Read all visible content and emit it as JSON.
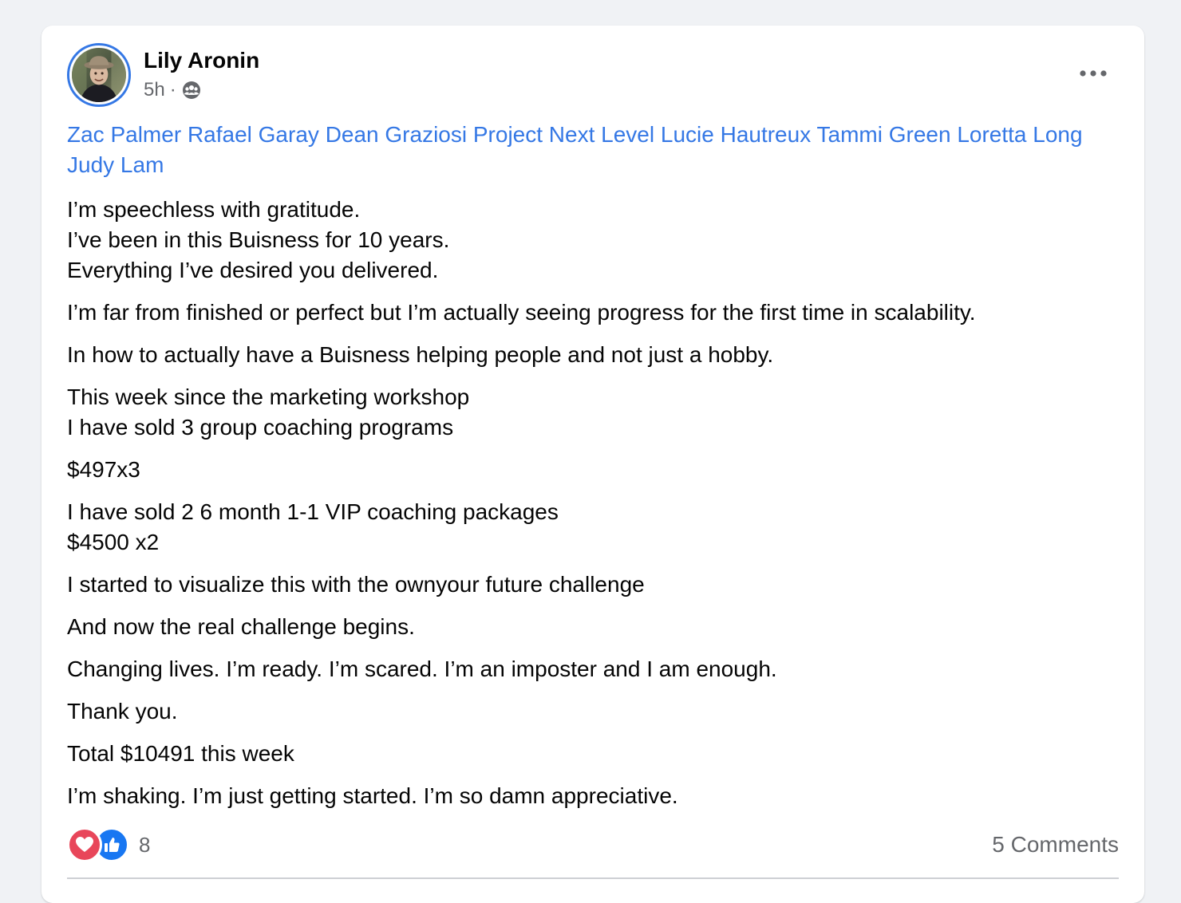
{
  "post": {
    "author": "Lily Aronin",
    "time": "5h",
    "separator": "·",
    "audience_icon": "friends-icon",
    "more_icon": "more-horizontal-icon",
    "tags": [
      "Zac Palmer",
      "Rafael Garay",
      "Dean Graziosi",
      "Project Next Level",
      "Lucie Hautreux",
      "Tammi Green",
      "Loretta Long",
      "Judy Lam"
    ],
    "paragraphs": [
      [
        "I’m speechless with gratitude.",
        "I’ve been in this Buisness for 10 years.",
        "Everything I’ve desired you delivered."
      ],
      [
        "I’m far from finished or perfect but I’m actually seeing progress for the first time in scalability."
      ],
      [
        "In how to actually have a Buisness helping people and not just a hobby."
      ],
      [
        "This week since the marketing workshop",
        "I have sold 3 group coaching programs"
      ],
      [
        "$497x3"
      ],
      [
        "I have sold 2 6 month 1-1 VIP coaching packages",
        "$4500 x2"
      ],
      [
        "I started to visualize this with the ownyour future challenge"
      ],
      [
        "And now the real challenge begins."
      ],
      [
        "Changing lives. I’m ready. I’m scared. I’m an imposter and I am enough."
      ],
      [
        "Thank you."
      ],
      [
        "Total $10491 this week"
      ],
      [
        "I’m shaking. I’m just getting started. I’m so damn appreciative."
      ]
    ],
    "reactions": {
      "icons": [
        "love-icon",
        "like-icon"
      ],
      "count": "8"
    },
    "comments_label": "5 Comments"
  },
  "colors": {
    "page_bg": "#f0f2f5",
    "card_bg": "#ffffff",
    "link": "#3578e5",
    "secondary_text": "#65676b",
    "love": "#e8465a",
    "like": "#1877f2"
  }
}
